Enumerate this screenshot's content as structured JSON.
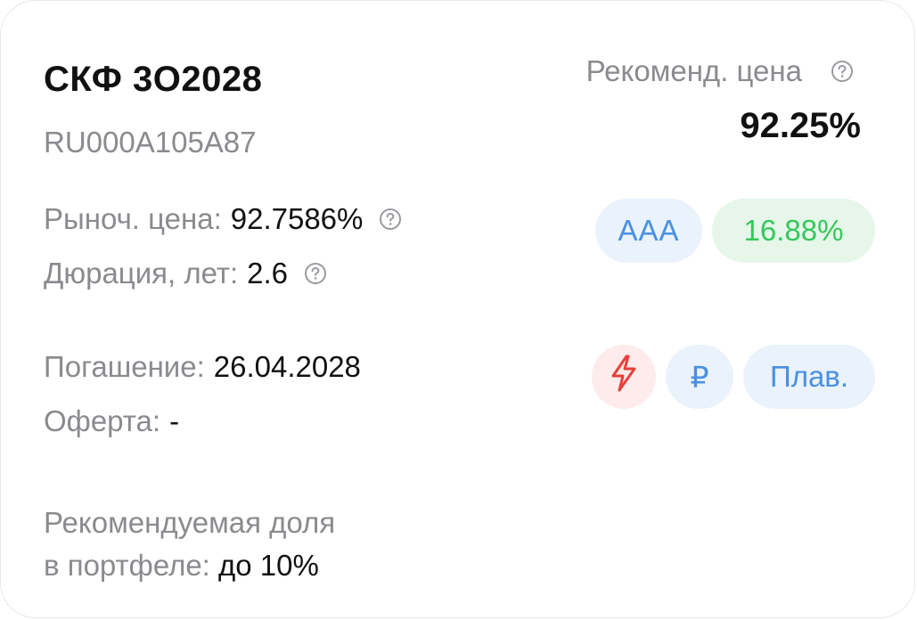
{
  "bond": {
    "name": "СКФ 3О2028",
    "isin": "RU000A105A87"
  },
  "recommended_price": {
    "label": "Рекоменд. цена",
    "value": "92.25%",
    "help_icon": "question-circle-icon"
  },
  "market_price": {
    "label": "Рыноч. цена:",
    "value": "92.7586%",
    "help_icon": "question-circle-icon"
  },
  "duration": {
    "label": "Дюрация, лет:",
    "value": "2.6",
    "help_icon": "question-circle-icon"
  },
  "maturity": {
    "label": "Погашение:",
    "value": "26.04.2028"
  },
  "offer": {
    "label": "Оферта:",
    "value": "-"
  },
  "portfolio_share": {
    "label_line1": "Рекомендуемая доля",
    "label_line2": "в портфеле:",
    "value": "до 10%"
  },
  "badges": {
    "rating": "AAA",
    "yield": "16.88%",
    "flash_icon": "lightning-icon",
    "currency": "₽",
    "coupon_type": "Плав."
  },
  "colors": {
    "accent_blue": "#4a90e2",
    "accent_green": "#35c75a",
    "accent_red": "#e8403a",
    "muted_text": "#8a8a8f"
  }
}
